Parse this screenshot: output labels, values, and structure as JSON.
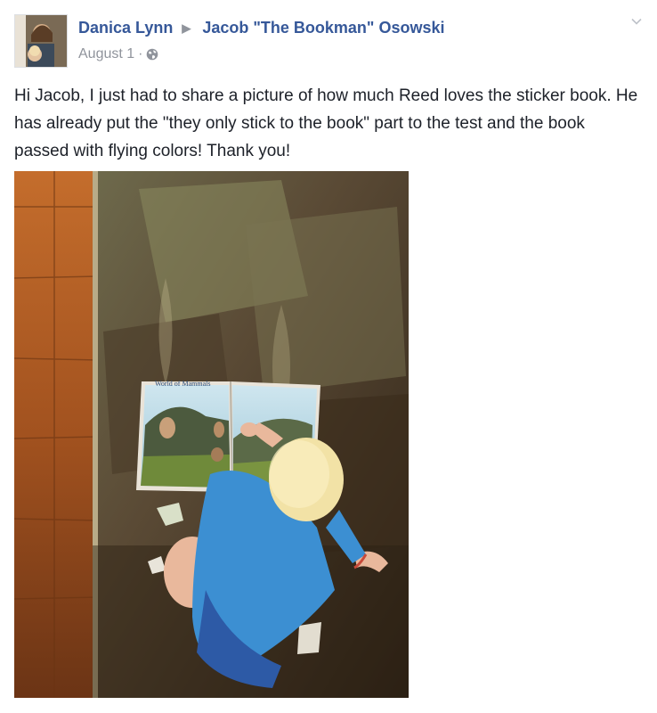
{
  "post": {
    "author": "Danica Lynn",
    "recipient": "Jacob \"The Bookman\" Osowski",
    "date": "August 1",
    "separator": "·",
    "privacy_icon": "globe-icon",
    "menu_icon": "chevron-down-icon",
    "message": "Hi Jacob, I just had to share a picture of how much Reed loves the sticker book. He has already put the \"they only stick to the book\" part to the test and the book passed with flying colors! Thank you!",
    "book_title": "World of Mammals"
  },
  "colors": {
    "link": "#365899",
    "meta": "#90949c",
    "text": "#1d2129"
  }
}
